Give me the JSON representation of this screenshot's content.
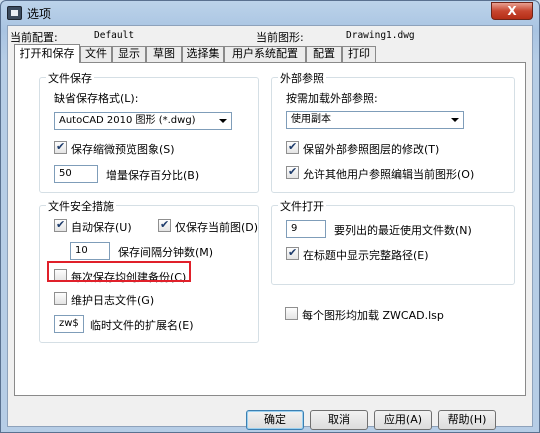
{
  "window": {
    "title": "选项",
    "close_label": "X"
  },
  "config": {
    "current_profile_label": "当前配置:",
    "current_profile_value": "Default",
    "current_drawing_label": "当前图形:",
    "current_drawing_value": "Drawing1.dwg"
  },
  "tabs": [
    "打开和保存",
    "文件",
    "显示",
    "草图",
    "选择集",
    "用户系统配置",
    "配置",
    "打印"
  ],
  "file_save": {
    "title": "文件保存",
    "format_label": "缺省保存格式(L):",
    "format_value": "AutoCAD 2010 图形 (*.dwg)",
    "save_thumbnail": {
      "label": "保存缩微预览图象(S)",
      "checked": true
    },
    "incremental_value": "50",
    "incremental_label": "增量保存百分比(B)"
  },
  "external_ref": {
    "title": "外部参照",
    "load_label": "按需加载外部参照:",
    "load_value": "使用副本",
    "retain_changes": {
      "label": "保留外部参照图层的修改(T)",
      "checked": true
    },
    "allow_edit": {
      "label": "允许其他用户参照编辑当前图形(O)",
      "checked": true
    }
  },
  "file_safety": {
    "title": "文件安全措施",
    "autosave": {
      "label": "自动保存(U)",
      "checked": true
    },
    "save_current_only": {
      "label": "仅保存当前图(D)",
      "checked": true
    },
    "interval_value": "10",
    "interval_label": "保存间隔分钟数(M)",
    "backup_each_save": {
      "label": "每次保存均创建备份(C)",
      "checked": false
    },
    "log_file": {
      "label": "维护日志文件(G)",
      "checked": false
    },
    "temp_ext_value": "zw$",
    "temp_ext_label": "临时文件的扩展名(E)"
  },
  "file_open": {
    "title": "文件打开",
    "recent_value": "9",
    "recent_label": "要列出的最近使用文件数(N)",
    "full_path": {
      "label": "在标题中显示完整路径(E)",
      "checked": true
    }
  },
  "load_zwcad": {
    "label": "每个图形均加载 ZWCAD.lsp",
    "checked": false
  },
  "buttons": {
    "ok": "确定",
    "cancel": "取消",
    "apply": "应用(A)",
    "help": "帮助(H)"
  }
}
